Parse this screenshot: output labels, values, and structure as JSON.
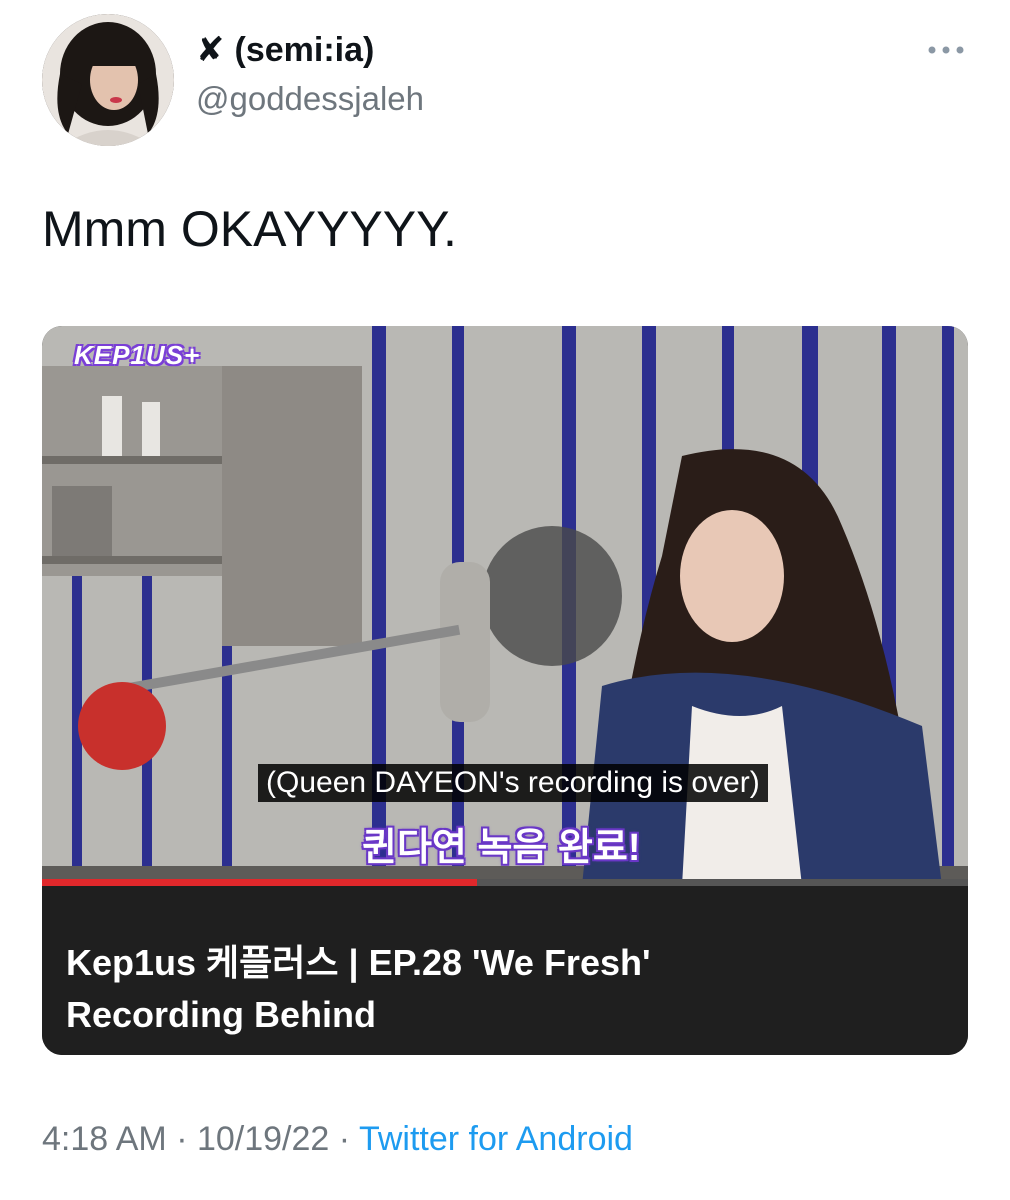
{
  "author": {
    "x_mark": "✘",
    "display_name": "(semi:ia)",
    "handle": "@goddessjaleh",
    "avatar_icon": "profile-avatar"
  },
  "more_icon": "more-horizontal-icon",
  "tweet": {
    "text": "Mmm OKAYYYYY."
  },
  "card": {
    "logo": "KEP1US+",
    "subtitle_en": "(Queen DAYEON's recording is over)",
    "subtitle_kr": "퀸다연 녹음 완료!",
    "title_line1": "Kep1us 케플러스 | EP.28 'We Fresh'",
    "title_line2": "Recording Behind",
    "progress": 0.47,
    "colors": {
      "progress": "#e0282b",
      "caption_bg": "#1f1f1f",
      "stripe": "#2c2f8f"
    }
  },
  "meta": {
    "time": "4:18 AM",
    "separator1": " · ",
    "date": "10/19/22",
    "separator2": " · ",
    "source": "Twitter for Android"
  },
  "colors": {
    "text": "#0f1419",
    "secondary": "#6e767d",
    "link": "#1d9bf0"
  }
}
